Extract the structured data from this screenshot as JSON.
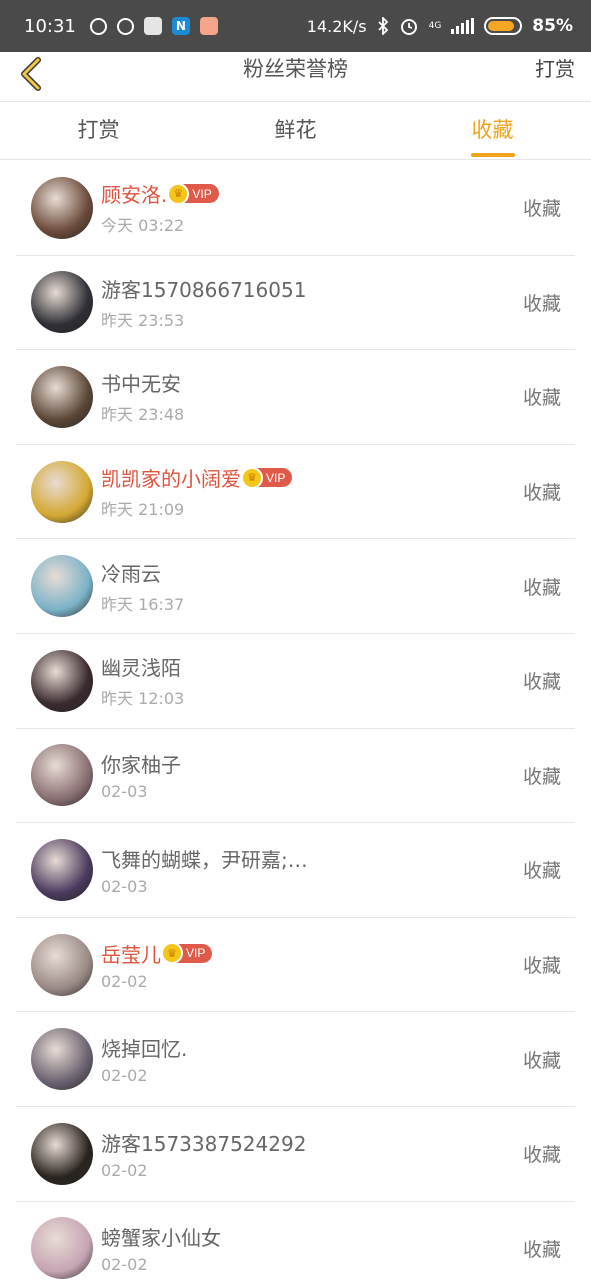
{
  "status_bar": {
    "time": "10:31",
    "speed": "14.2K/s",
    "net": "4G",
    "battery": "85%",
    "battery_level": 0.85,
    "icons": [
      "weibo-icon",
      "wechat-icon",
      "n-app-icon",
      "mail-icon",
      "bluetooth-icon",
      "alarm-icon",
      "signal-icon",
      "battery-icon"
    ]
  },
  "header": {
    "title": "粉丝荣誉榜",
    "action": "打赏"
  },
  "tabs": [
    {
      "label": "打赏"
    },
    {
      "label": "鲜花"
    },
    {
      "label": "收藏"
    }
  ],
  "active_tab": 2,
  "vip_label": "VIP",
  "accent_color": "#f0a41b",
  "vip_name_color": "#e0533d",
  "fans": [
    {
      "name": "顾安洛.",
      "time": "今天 03:22",
      "vip": true,
      "action": "收藏",
      "avatar_color": "#6b4a3a"
    },
    {
      "name": "游客1570866716051",
      "time": "昨天 23:53",
      "vip": false,
      "action": "收藏",
      "avatar_color": "#2e2e35"
    },
    {
      "name": "书中无安",
      "time": "昨天 23:48",
      "vip": false,
      "action": "收藏",
      "avatar_color": "#5a4636"
    },
    {
      "name": "凯凯家的小阔爱",
      "time": "昨天 21:09",
      "vip": true,
      "action": "收藏",
      "avatar_color": "#d4a832"
    },
    {
      "name": "冷雨云",
      "time": "昨天 16:37",
      "vip": false,
      "action": "收藏",
      "avatar_color": "#7bb2c8"
    },
    {
      "name": "幽灵浅陌",
      "time": "昨天 12:03",
      "vip": false,
      "action": "收藏",
      "avatar_color": "#3a2a2e"
    },
    {
      "name": "你家柚子",
      "time": "02-03",
      "vip": false,
      "action": "收藏",
      "avatar_color": "#8a7074"
    },
    {
      "name": "飞舞的蝴蝶，尹研嘉;…",
      "time": "02-03",
      "vip": false,
      "action": "收藏",
      "avatar_color": "#4a3a5e"
    },
    {
      "name": "岳莹儿",
      "time": "02-02",
      "vip": true,
      "action": "收藏",
      "avatar_color": "#9a8a86"
    },
    {
      "name": "烧掉回忆.",
      "time": "02-02",
      "vip": false,
      "action": "收藏",
      "avatar_color": "#6a6270"
    },
    {
      "name": "游客1573387524292",
      "time": "02-02",
      "vip": false,
      "action": "收藏",
      "avatar_color": "#2a2420"
    },
    {
      "name": "螃蟹家小仙女",
      "time": "02-02",
      "vip": false,
      "action": "收藏",
      "avatar_color": "#c6a4b4"
    }
  ]
}
